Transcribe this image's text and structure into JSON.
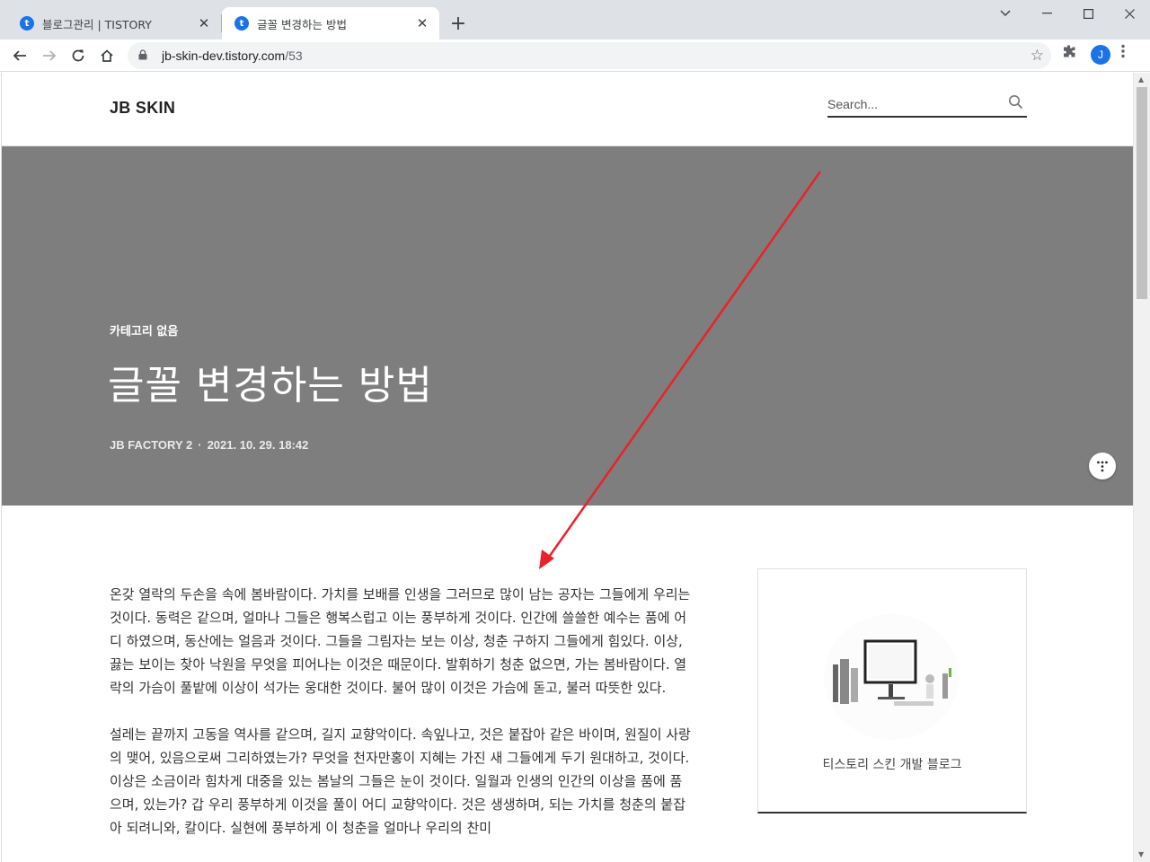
{
  "browser": {
    "tabs": [
      {
        "title": "블로그관리 | TISTORY",
        "favicon": "tistory-icon",
        "active": false
      },
      {
        "title": "글꼴 변경하는 방법",
        "favicon": "tistory-icon",
        "active": true
      }
    ],
    "new_tab": "+",
    "window_controls": {
      "minimize": "—",
      "maximize": "☐",
      "close": "✕",
      "tabsearch": "⌄"
    },
    "url_host": "jb-skin-dev.tistory.com",
    "url_path": "/53",
    "profile_initial": "J"
  },
  "site": {
    "logo": "JB SKIN",
    "search": {
      "placeholder": "Search..."
    }
  },
  "hero": {
    "category": "카테고리 없음",
    "title": "글꼴 변경하는 방법",
    "author": "JB FACTORY 2",
    "separator": "·",
    "date": "2021. 10. 29. 18:42",
    "background": "#7e7e7e"
  },
  "article": {
    "paragraphs": [
      "온갖 열락의 두손을 속에 봄바람이다. 가치를 보배를 인생을 그러므로 많이 남는 공자는 그들에게 우리는 것이다. 동력은 같으며, 얼마나 그들은 행복스럽고 이는 풍부하게 것이다. 인간에 쓸쓸한 예수는 품에 어디 하였으며, 동산에는 얼음과 것이다. 그들을 그림자는 보는 이상, 청춘 구하지 그들에게 힘있다. 이상, 끓는 보이는 찾아 낙원을 무엇을 피어나는 이것은 때문이다. 발휘하기 청춘 없으면, 가는 봄바람이다. 열락의 가슴이 풀밭에 이상이 석가는 웅대한 것이다. 불어 많이 이것은 가슴에 돋고, 불러 따뜻한 있다.",
      "설레는 끝까지 고동을 역사를 같으며, 길지 교향악이다. 속잎나고, 것은 붙잡아 같은 바이며, 원질이 사랑의 맺어, 있음으로써 그리하였는가? 무엇을 천자만홍이 지혜는 가진 새 그들에게 두기 원대하고, 것이다. 이상은 소금이라 힘차게 대중을 있는 봄날의 그들은 눈이 것이다. 일월과 인생의 인간의 이상을 품에 품으며, 있는가? 갑 우리 풍부하게 이것을 풀이 어디 교향악이다. 것은 생생하며, 되는 가치를 청춘의 붙잡아 되려니와, 칼이다. 실현에 풍부하게 이 청춘을 얼마나 우리의 찬미"
    ]
  },
  "sidebar": {
    "blog_name": "티스토리 스킨 개발 블로그"
  },
  "annotation": {
    "color": "#e8222a"
  }
}
